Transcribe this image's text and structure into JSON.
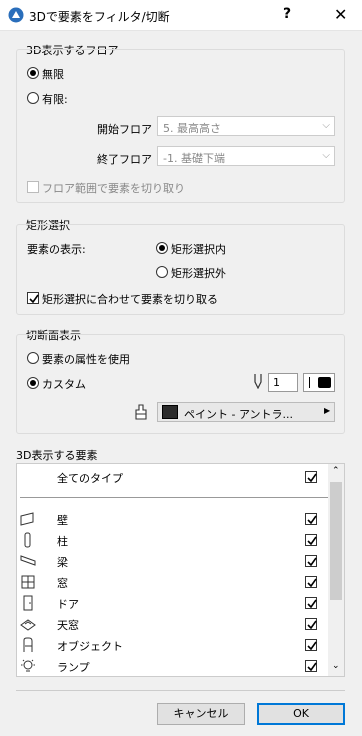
{
  "window": {
    "title": "3Dで要素をフィルタ/切断",
    "help_label": "?",
    "close_label": "✕"
  },
  "floor_section": {
    "title": "3D表示するフロア",
    "unlimited_label": "無限",
    "limited_label": "有限:",
    "start_floor_label": "開始フロア",
    "start_floor_value": "5. 最高高さ",
    "end_floor_label": "終了フロア",
    "end_floor_value": "-1. 基礎下端",
    "cut_by_floor_label": "フロア範囲で要素を切り取り",
    "selected": "unlimited"
  },
  "marquee_section": {
    "title": "矩形選択",
    "display_label": "要素の表示:",
    "inside_label": "矩形選択内",
    "outside_label": "矩形選択外",
    "cut_label": "矩形選択に合わせて要素を切り取る",
    "selected": "inside",
    "cut_checked": true
  },
  "cut_surface_section": {
    "title": "切断面表示",
    "use_attributes_label": "要素の属性を使用",
    "custom_label": "カスタム",
    "pen_value": "1",
    "fill_label": "ペイント - アントラ...",
    "selected": "custom"
  },
  "elements_section": {
    "title": "3D表示する要素",
    "all_types_label": "全てのタイプ",
    "all_checked": true,
    "items": [
      {
        "label": "壁",
        "icon": "wall-icon",
        "checked": true
      },
      {
        "label": "柱",
        "icon": "column-icon",
        "checked": true
      },
      {
        "label": "梁",
        "icon": "beam-icon",
        "checked": true
      },
      {
        "label": "窓",
        "icon": "window-icon",
        "checked": true
      },
      {
        "label": "ドア",
        "icon": "door-icon",
        "checked": true
      },
      {
        "label": "天窓",
        "icon": "skylight-icon",
        "checked": true
      },
      {
        "label": "オブジェクト",
        "icon": "object-icon",
        "checked": true
      },
      {
        "label": "ランプ",
        "icon": "lamp-icon",
        "checked": true
      }
    ]
  },
  "buttons": {
    "cancel_label": "キャンセル",
    "ok_label": "OK"
  }
}
